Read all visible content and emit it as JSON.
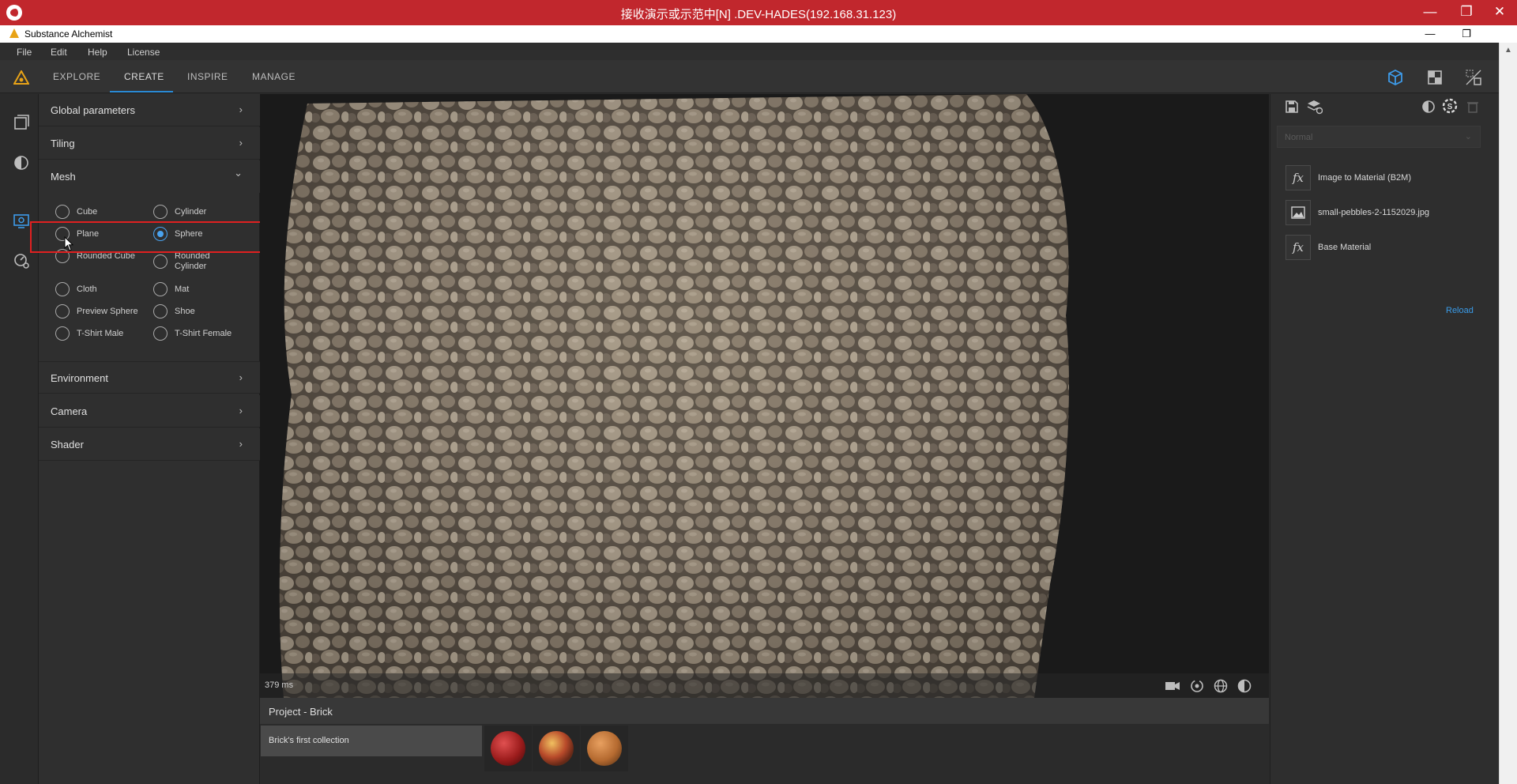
{
  "remote_window": {
    "title": "接收演示或示范中[N] .DEV-HADES(192.168.31.123)",
    "minimize": "—",
    "maximize": "❐",
    "close": "✕"
  },
  "app_window": {
    "title": "Substance Alchemist",
    "minimize": "—",
    "restore": "❐"
  },
  "menu": [
    "File",
    "Edit",
    "Help",
    "License"
  ],
  "tabs": [
    {
      "label": "EXPLORE",
      "active": false
    },
    {
      "label": "CREATE",
      "active": true
    },
    {
      "label": "INSPIRE",
      "active": false
    },
    {
      "label": "MANAGE",
      "active": false
    }
  ],
  "top_right_icons": [
    "3d-view-icon",
    "2d-view-icon",
    "split-view-icon"
  ],
  "left_rail_icons": [
    "library-icon",
    "material-icon",
    "render-settings-icon",
    "settings-icon"
  ],
  "sections": {
    "global_parameters": {
      "label": "Global parameters",
      "state": "collapsed",
      "chevron": "›"
    },
    "tiling": {
      "label": "Tiling",
      "state": "collapsed",
      "chevron": "›"
    },
    "mesh": {
      "label": "Mesh",
      "state": "expanded",
      "chevron": "⌄"
    },
    "environment": {
      "label": "Environment",
      "state": "collapsed",
      "chevron": "›"
    },
    "camera": {
      "label": "Camera",
      "state": "collapsed",
      "chevron": "›"
    },
    "shader": {
      "label": "Shader",
      "state": "collapsed",
      "chevron": "›"
    }
  },
  "mesh_options": {
    "cube": "Cube",
    "cylinder": "Cylinder",
    "plane": "Plane",
    "sphere": "Sphere",
    "rounded_cube": "Rounded Cube",
    "rounded_cylinder_line1": "Rounded",
    "rounded_cylinder_line2": "Cylinder",
    "cloth": "Cloth",
    "mat": "Mat",
    "preview_sphere": "Preview Sphere",
    "shoe": "Shoe",
    "tshirt_male": "T-Shirt Male",
    "tshirt_female": "T-Shirt Female",
    "selected": "Sphere"
  },
  "viewport": {
    "render_time": "379 ms",
    "footer_icons": [
      "camera-icon",
      "rotate-light-icon",
      "environment-icon",
      "shading-icon"
    ]
  },
  "project": {
    "title": "Project - Brick",
    "collection": "Brick's first collection",
    "thumbnails": [
      "red-material-thumbnail",
      "mixed-material-thumbnail",
      "orange-material-thumbnail"
    ]
  },
  "right_panel": {
    "toolbar_icons": [
      "save-icon",
      "add-layer-icon",
      "mask-icon",
      "substance-icon",
      "delete-icon"
    ],
    "blend_mode": "Normal",
    "layers": [
      {
        "icon": "fx",
        "label": "Image to Material (B2M)"
      },
      {
        "icon": "image",
        "label": "small-pebbles-2-1152029.jpg"
      },
      {
        "icon": "fx",
        "label": "Base Material"
      }
    ],
    "reload": "Reload"
  },
  "colors": {
    "accent": "#2a8ad4",
    "radio_selected": "#4aa3ef",
    "highlight": "#e02020",
    "remote_bar": "#c1272d",
    "link": "#3a9be8"
  }
}
